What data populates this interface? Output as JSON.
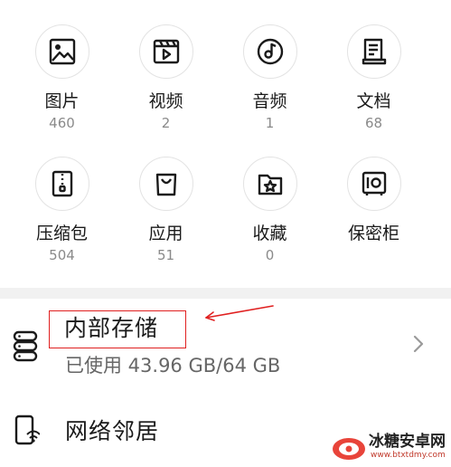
{
  "categories": [
    {
      "label": "图片",
      "count": "460",
      "icon": "image-icon"
    },
    {
      "label": "视频",
      "count": "2",
      "icon": "video-icon"
    },
    {
      "label": "音频",
      "count": "1",
      "icon": "audio-icon"
    },
    {
      "label": "文档",
      "count": "68",
      "icon": "document-icon"
    },
    {
      "label": "压缩包",
      "count": "504",
      "icon": "zip-icon"
    },
    {
      "label": "应用",
      "count": "51",
      "icon": "app-bag-icon"
    },
    {
      "label": "收藏",
      "count": "0",
      "icon": "star-folder-icon"
    },
    {
      "label": "保密柜",
      "count": "",
      "icon": "safe-icon"
    }
  ],
  "storage": {
    "title": "内部存储",
    "usage": "已使用 43.96 GB/64 GB",
    "icon": "storage-icon"
  },
  "network": {
    "title": "网络邻居",
    "icon": "network-device-icon"
  },
  "annotation": {
    "highlight_color": "#e02020"
  },
  "watermark": {
    "name": "冰糖安卓网",
    "url": "www.btxtdmy.com"
  }
}
